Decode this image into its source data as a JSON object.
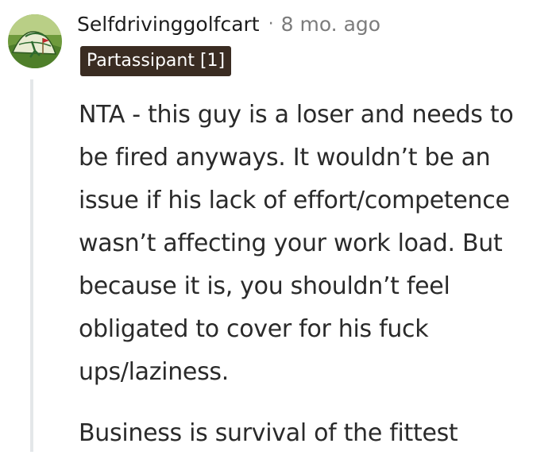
{
  "comment": {
    "username": "Selfdrivinggolfcart",
    "separator": "·",
    "timestamp": "8 mo. ago",
    "flair": "Partassipant [1]",
    "avatar_icon": "masters-golf-avatar-icon",
    "paragraphs": [
      {
        "lines": [
          "NTA - this guy is a loser and needs to",
          "be fired anyways. It wouldn’t be an",
          "issue if his lack of effort/competence",
          "wasn’t affecting your work load. But",
          "because it is, you shouldn’t feel",
          "obligated to cover for his fuck",
          "ups/laziness."
        ]
      },
      {
        "lines": [
          "Business is survival of the fittest"
        ]
      }
    ]
  },
  "colors": {
    "flair_background": "#3a2c22",
    "meta_gray": "#7c7c7c",
    "thread_line": "#e4e7e9"
  }
}
